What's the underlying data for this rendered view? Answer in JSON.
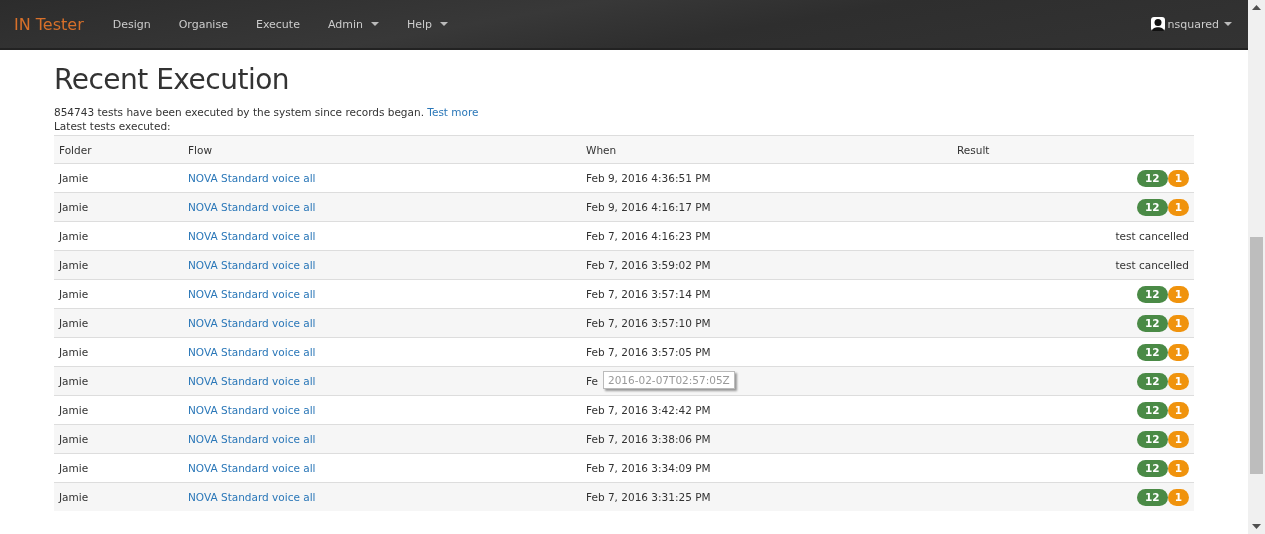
{
  "navbar": {
    "brand": "IN Tester",
    "items": [
      {
        "label": "Design",
        "dropdown": false
      },
      {
        "label": "Organise",
        "dropdown": false
      },
      {
        "label": "Execute",
        "dropdown": false
      },
      {
        "label": "Admin",
        "dropdown": true
      },
      {
        "label": "Help",
        "dropdown": true
      }
    ],
    "user": "nsquared"
  },
  "heading": "Recent Execution",
  "summary": "854743 tests have been executed by the system since records began.",
  "summary_link": "Test more",
  "subheading": "Latest tests executed:",
  "table": {
    "columns": [
      "Folder",
      "Flow",
      "When",
      "Result"
    ],
    "rows": [
      {
        "folder": "Jamie",
        "flow": "NOVA Standard voice all",
        "when": "Feb 9, 2016 4:36:51 PM",
        "result": {
          "kind": "badges",
          "passed": "12",
          "failed": "1"
        }
      },
      {
        "folder": "Jamie",
        "flow": "NOVA Standard voice all",
        "when": "Feb 9, 2016 4:16:17 PM",
        "result": {
          "kind": "badges",
          "passed": "12",
          "failed": "1"
        }
      },
      {
        "folder": "Jamie",
        "flow": "NOVA Standard voice all",
        "when": "Feb 7, 2016 4:16:23 PM",
        "result": {
          "kind": "text",
          "text": "test cancelled"
        }
      },
      {
        "folder": "Jamie",
        "flow": "NOVA Standard voice all",
        "when": "Feb 7, 2016 3:59:02 PM",
        "result": {
          "kind": "text",
          "text": "test cancelled"
        }
      },
      {
        "folder": "Jamie",
        "flow": "NOVA Standard voice all",
        "when": "Feb 7, 2016 3:57:14 PM",
        "result": {
          "kind": "badges",
          "passed": "12",
          "failed": "1"
        }
      },
      {
        "folder": "Jamie",
        "flow": "NOVA Standard voice all",
        "when": "Feb 7, 2016 3:57:10 PM",
        "result": {
          "kind": "badges",
          "passed": "12",
          "failed": "1"
        }
      },
      {
        "folder": "Jamie",
        "flow": "NOVA Standard voice all",
        "when": "Feb 7, 2016 3:57:05 PM",
        "result": {
          "kind": "badges",
          "passed": "12",
          "failed": "1"
        }
      },
      {
        "folder": "Jamie",
        "flow": "NOVA Standard voice all",
        "when": "Fe",
        "tooltip": "2016-02-07T02:57:05Z",
        "result": {
          "kind": "badges",
          "passed": "12",
          "failed": "1"
        }
      },
      {
        "folder": "Jamie",
        "flow": "NOVA Standard voice all",
        "when": "Feb 7, 2016 3:42:42 PM",
        "result": {
          "kind": "badges",
          "passed": "12",
          "failed": "1"
        }
      },
      {
        "folder": "Jamie",
        "flow": "NOVA Standard voice all",
        "when": "Feb 7, 2016 3:38:06 PM",
        "result": {
          "kind": "badges",
          "passed": "12",
          "failed": "1"
        }
      },
      {
        "folder": "Jamie",
        "flow": "NOVA Standard voice all",
        "when": "Feb 7, 2016 3:34:09 PM",
        "result": {
          "kind": "badges",
          "passed": "12",
          "failed": "1"
        }
      },
      {
        "folder": "Jamie",
        "flow": "NOVA Standard voice all",
        "when": "Feb 7, 2016 3:31:25 PM",
        "result": {
          "kind": "badges",
          "passed": "12",
          "failed": "1"
        }
      }
    ]
  }
}
